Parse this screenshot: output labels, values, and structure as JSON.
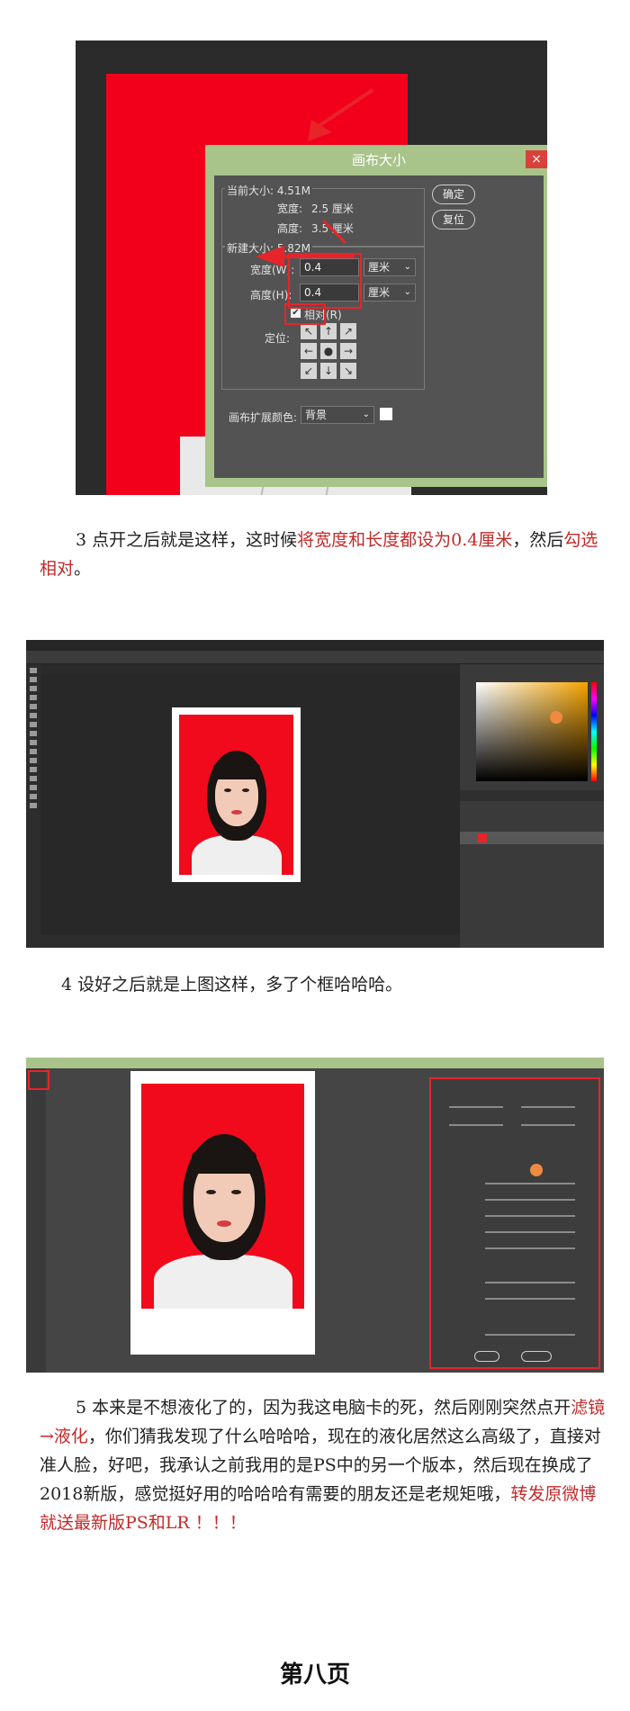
{
  "dialog": {
    "title": "画布大小",
    "current_size_label": "当前大小: 4.51M",
    "width_label": "宽度:",
    "width_value": "2.5 厘米",
    "height_label": "高度:",
    "height_value": "3.5 厘米",
    "new_size_label": "新建大小: 5.82M",
    "new_width_label": "宽度(W):",
    "new_width_value": "0.4",
    "new_height_label": "高度(H):",
    "new_height_value": "0.4",
    "unit_option": "厘米",
    "relative_label": "相对(R)",
    "anchor_label": "定位:",
    "ext_color_label": "画布扩展颜色:",
    "ext_color_value": "背景",
    "ok_label": "确定",
    "reset_label": "复位",
    "close_glyph": "×"
  },
  "step3": {
    "prefix": "3 点开之后就是这样，这时候",
    "red1": "将宽度和长度都设为0.4厘米",
    "mid": "，然后",
    "red2": "勾选相对",
    "suffix": "。"
  },
  "step4": {
    "text": "4 设好之后就是上图这样，多了个框哈哈哈。"
  },
  "step5": {
    "prefix": "5 本来是不想液化了的，因为我这电脑卡的死，然后刚刚突然点开",
    "red1": "滤镜→液化",
    "mid": "，你们猜我发现了什么哈哈哈，现在的液化居然这么高级了，直接对准人脸，好吧，我承认之前我用的是PS中的另一个版本，然后现在换成了2018新版，感觉挺好用的哈哈哈有需要的朋友还是老规矩哦，",
    "red2": "转发原微博就送最新版PS和LR ！！！"
  },
  "footer": "第八页",
  "colors": {
    "highlight": "#e8242a",
    "dialog_frame": "#a8c48a",
    "photo_bg": "#f10a1c"
  }
}
